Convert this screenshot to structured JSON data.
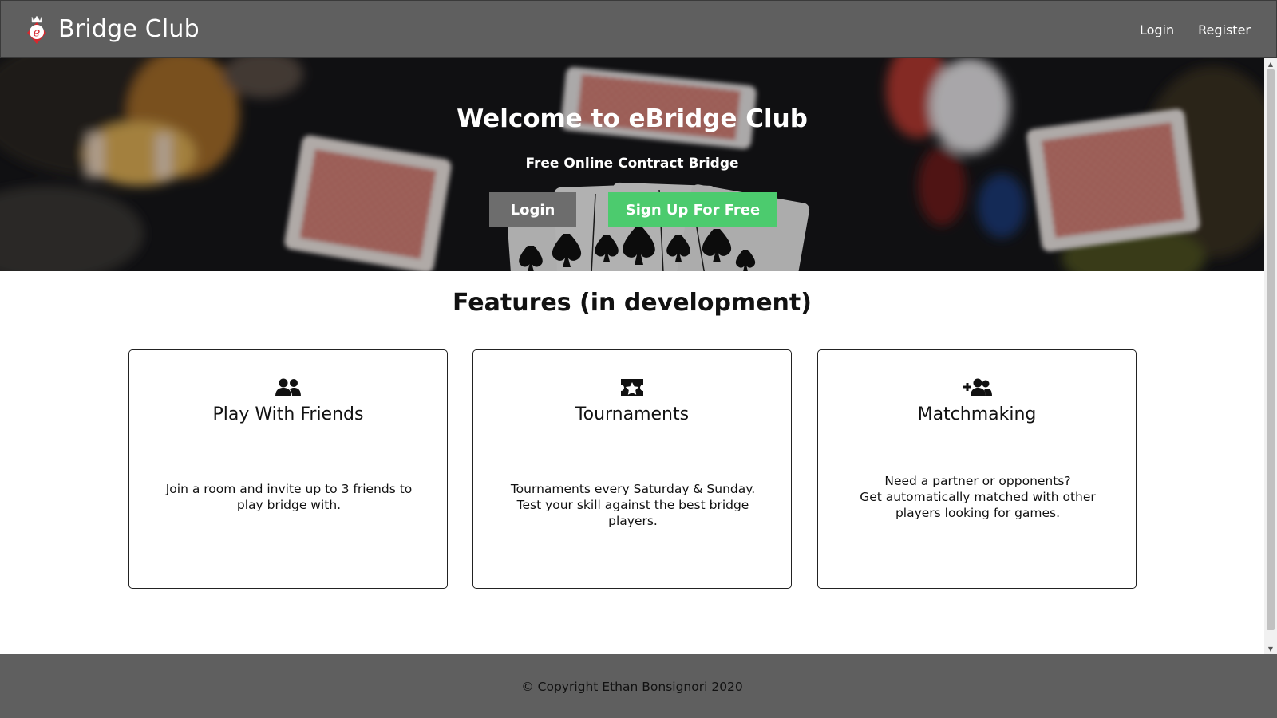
{
  "navbar": {
    "brand_name": "Bridge Club",
    "links": [
      {
        "label": "Login"
      },
      {
        "label": "Register"
      }
    ]
  },
  "hero": {
    "title": "Welcome to eBridge Club",
    "subtitle": "Free Online Contract Bridge",
    "login_button": "Login",
    "signup_button": "Sign Up For Free"
  },
  "features": {
    "heading": "Features (in development)",
    "cards": [
      {
        "icon": "users-icon",
        "title": "Play With Friends",
        "text": "Join a room and invite up to 3 friends to play bridge with."
      },
      {
        "icon": "star-ticket-icon",
        "title": "Tournaments",
        "text": "Tournaments every Saturday & Sunday. Test your skill against the best bridge players."
      },
      {
        "icon": "user-plus-icon",
        "title": "Matchmaking",
        "text": "Need a partner or opponents?\nGet automatically matched with other players looking for games."
      }
    ]
  },
  "footer": {
    "copyright": "© Copyright Ethan Bonsignori 2020"
  },
  "colors": {
    "navbar_bg": "#5f5f5f",
    "signup_green": "#4ccb6e",
    "login_gray": "#6d6d6d"
  }
}
